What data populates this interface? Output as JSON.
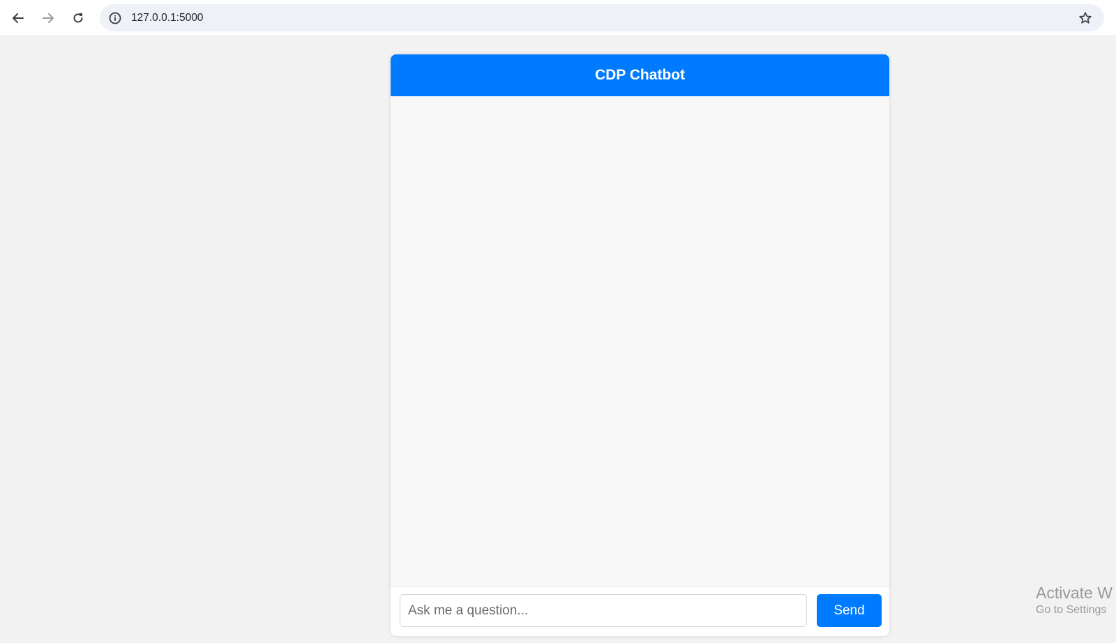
{
  "browser": {
    "url": "127.0.0.1:5000",
    "icons": {
      "back": "arrow-left-icon",
      "forward": "arrow-right-icon",
      "reload": "reload-icon",
      "site_info": "info-icon",
      "bookmark": "star-icon"
    }
  },
  "chat": {
    "title": "CDP Chatbot",
    "input_placeholder": "Ask me a question...",
    "input_value": "",
    "send_label": "Send",
    "messages": []
  },
  "watermark": {
    "line1": "Activate W",
    "line2": "Go to Settings"
  },
  "colors": {
    "accent": "#007bff",
    "page_background": "#f2f2f2",
    "chat_background": "#f8f8f8",
    "omnibox": "#eef1f8"
  }
}
